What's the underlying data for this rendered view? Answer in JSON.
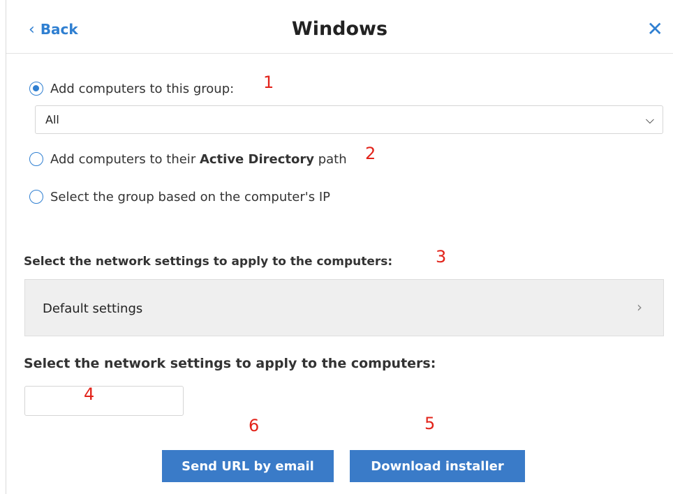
{
  "header": {
    "back_label": "Back",
    "title": "Windows"
  },
  "options": {
    "opt1_label": "Add computers to this group:",
    "group_select_value": "All",
    "opt2_prefix": "Add computers to their ",
    "opt2_bold": "Active Directory",
    "opt2_suffix": " path",
    "opt3_label": "Select the group based on the computer's IP"
  },
  "network": {
    "section1_label": "Select the network settings to apply to the computers:",
    "settings_value": "Default settings",
    "section2_label": "Select the network settings to apply to the computers:"
  },
  "buttons": {
    "send_url_label": "Send URL by email",
    "download_label": "Download installer"
  },
  "annotations": [
    "1",
    "2",
    "3",
    "4",
    "5",
    "6"
  ],
  "colors": {
    "accent": "#2f7fd1",
    "button": "#3a7bc8",
    "annotation": "#e2231a"
  }
}
